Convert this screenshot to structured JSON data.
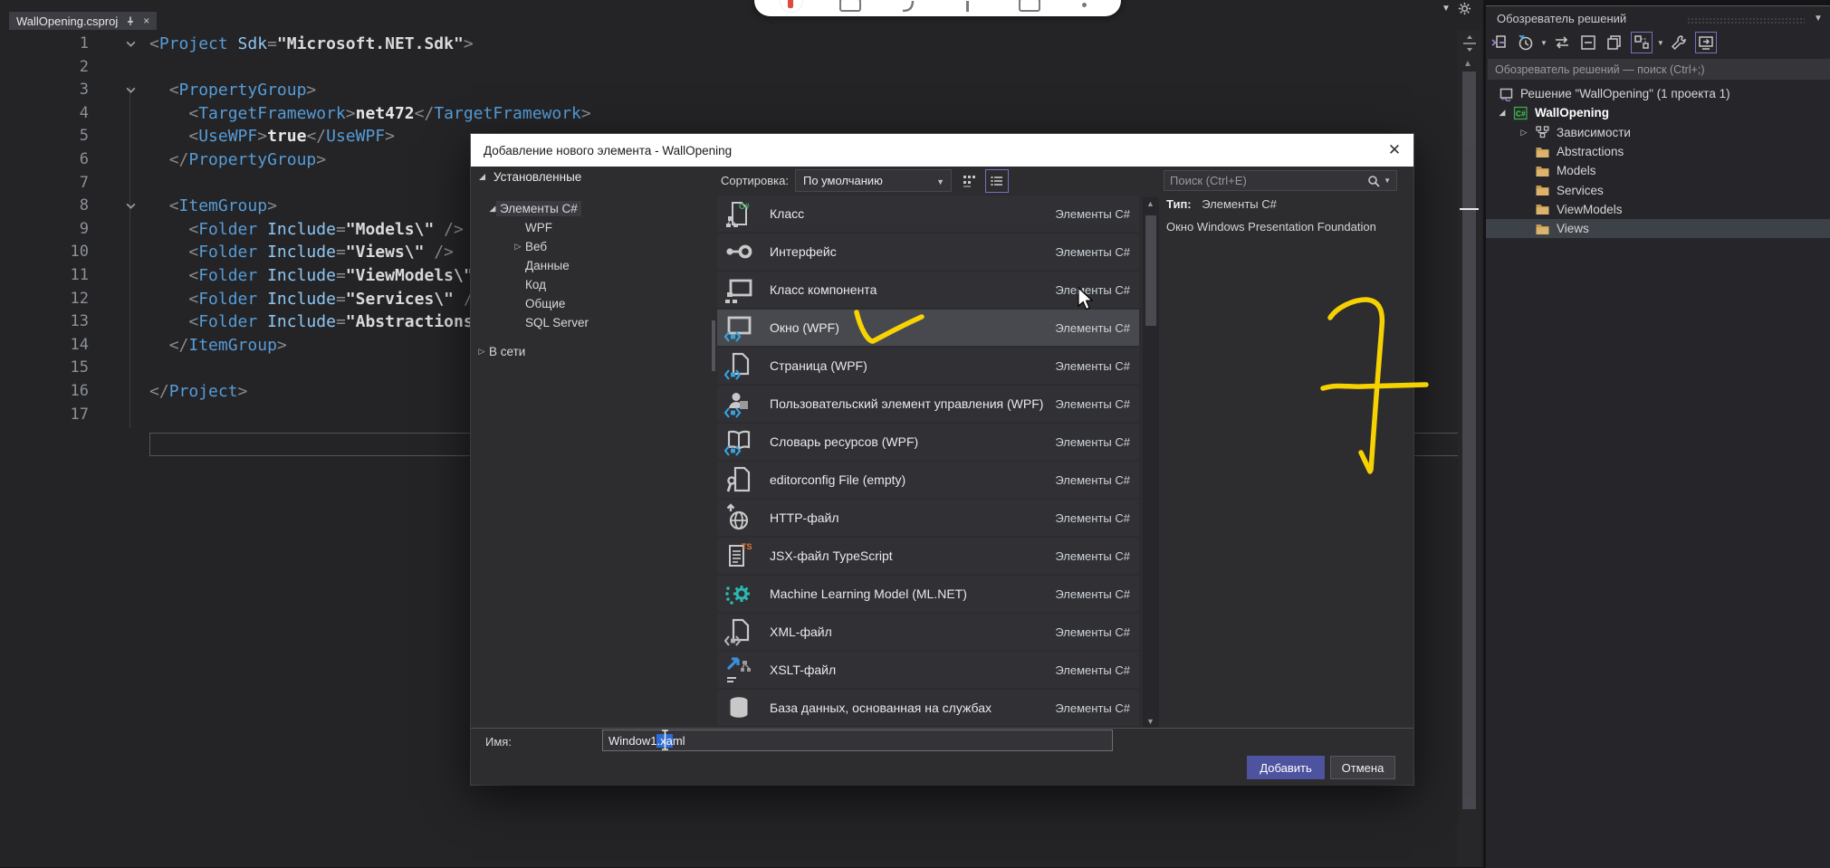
{
  "recorder": {
    "icons": [
      "record-icon",
      "screen-icon",
      "pen-icon",
      "divider",
      "camera-icon",
      "menu-dot-icon"
    ]
  },
  "editor": {
    "tab_title": "WallOpening.csproj",
    "lines": [
      {
        "n": 1,
        "fold": true,
        "tokens": [
          [
            "p",
            "<"
          ],
          [
            "t",
            "Project"
          ],
          [
            "x",
            " "
          ],
          [
            "a",
            "Sdk"
          ],
          [
            "p",
            "="
          ],
          [
            "s",
            "\"Microsoft.NET.Sdk\""
          ],
          [
            "p",
            ">"
          ]
        ]
      },
      {
        "n": 2,
        "tokens": []
      },
      {
        "n": 3,
        "fold": true,
        "tokens": [
          [
            "x",
            "  "
          ],
          [
            "p",
            "<"
          ],
          [
            "t",
            "PropertyGroup"
          ],
          [
            "p",
            ">"
          ]
        ]
      },
      {
        "n": 4,
        "tokens": [
          [
            "x",
            "    "
          ],
          [
            "p",
            "<"
          ],
          [
            "t",
            "TargetFramework"
          ],
          [
            "p",
            ">"
          ],
          [
            "x",
            "net472"
          ],
          [
            "p",
            "</"
          ],
          [
            "t",
            "TargetFramework"
          ],
          [
            "p",
            ">"
          ]
        ]
      },
      {
        "n": 5,
        "tokens": [
          [
            "x",
            "    "
          ],
          [
            "p",
            "<"
          ],
          [
            "t",
            "UseWPF"
          ],
          [
            "p",
            ">"
          ],
          [
            "x",
            "true"
          ],
          [
            "p",
            "</"
          ],
          [
            "t",
            "UseWPF"
          ],
          [
            "p",
            ">"
          ]
        ]
      },
      {
        "n": 6,
        "tokens": [
          [
            "x",
            "  "
          ],
          [
            "p",
            "</"
          ],
          [
            "t",
            "PropertyGroup"
          ],
          [
            "p",
            ">"
          ]
        ]
      },
      {
        "n": 7,
        "tokens": []
      },
      {
        "n": 8,
        "fold": true,
        "tokens": [
          [
            "x",
            "  "
          ],
          [
            "p",
            "<"
          ],
          [
            "t",
            "ItemGroup"
          ],
          [
            "p",
            ">"
          ]
        ]
      },
      {
        "n": 9,
        "tokens": [
          [
            "x",
            "    "
          ],
          [
            "p",
            "<"
          ],
          [
            "t",
            "Folder"
          ],
          [
            "x",
            " "
          ],
          [
            "a",
            "Include"
          ],
          [
            "p",
            "="
          ],
          [
            "s",
            "\"Models\\\""
          ],
          [
            "x",
            " "
          ],
          [
            "p",
            "/>"
          ]
        ]
      },
      {
        "n": 10,
        "tokens": [
          [
            "x",
            "    "
          ],
          [
            "p",
            "<"
          ],
          [
            "t",
            "Folder"
          ],
          [
            "x",
            " "
          ],
          [
            "a",
            "Include"
          ],
          [
            "p",
            "="
          ],
          [
            "s",
            "\"Views\\\""
          ],
          [
            "x",
            " "
          ],
          [
            "p",
            "/>"
          ]
        ]
      },
      {
        "n": 11,
        "tokens": [
          [
            "x",
            "    "
          ],
          [
            "p",
            "<"
          ],
          [
            "t",
            "Folder"
          ],
          [
            "x",
            " "
          ],
          [
            "a",
            "Include"
          ],
          [
            "p",
            "="
          ],
          [
            "s",
            "\"ViewModels\\\""
          ],
          [
            "x",
            " "
          ],
          [
            "p",
            "/>"
          ]
        ]
      },
      {
        "n": 12,
        "tokens": [
          [
            "x",
            "    "
          ],
          [
            "p",
            "<"
          ],
          [
            "t",
            "Folder"
          ],
          [
            "x",
            " "
          ],
          [
            "a",
            "Include"
          ],
          [
            "p",
            "="
          ],
          [
            "s",
            "\"Services\\\""
          ],
          [
            "x",
            " "
          ],
          [
            "p",
            "/>"
          ]
        ]
      },
      {
        "n": 13,
        "tokens": [
          [
            "x",
            "    "
          ],
          [
            "p",
            "<"
          ],
          [
            "t",
            "Folder"
          ],
          [
            "x",
            " "
          ],
          [
            "a",
            "Include"
          ],
          [
            "p",
            "="
          ],
          [
            "s",
            "\"Abstractions\\\""
          ],
          [
            "x",
            " "
          ],
          [
            "p",
            "/>"
          ]
        ]
      },
      {
        "n": 14,
        "tokens": [
          [
            "x",
            "  "
          ],
          [
            "p",
            "</"
          ],
          [
            "t",
            "ItemGroup"
          ],
          [
            "p",
            ">"
          ]
        ]
      },
      {
        "n": 15,
        "tokens": []
      },
      {
        "n": 16,
        "tokens": [
          [
            "p",
            "</"
          ],
          [
            "t",
            "Project"
          ],
          [
            "p",
            ">"
          ]
        ]
      },
      {
        "n": 17,
        "tokens": []
      }
    ]
  },
  "dialog": {
    "title": "Добавление нового элемента  - WallOpening",
    "installed_label": "Установленные",
    "categories": [
      {
        "label": "Элементы C#",
        "indent": 1,
        "state": "expanded",
        "highlight": true
      },
      {
        "label": "WPF",
        "indent": 2,
        "state": ""
      },
      {
        "label": "Веб",
        "indent": 2,
        "state": "collapsed"
      },
      {
        "label": "Данные",
        "indent": 2,
        "state": ""
      },
      {
        "label": "Код",
        "indent": 2,
        "state": ""
      },
      {
        "label": "Общие",
        "indent": 2,
        "state": ""
      },
      {
        "label": "SQL Server",
        "indent": 2,
        "state": ""
      },
      {
        "label": "В сети",
        "indent": 0,
        "state": "collapsed"
      }
    ],
    "sort_label": "Сортировка:",
    "sort_value": "По умолчанию",
    "search_placeholder": "Поиск (Ctrl+E)",
    "templates": [
      {
        "icon": "i-class",
        "label": "Класс",
        "category": "Элементы C#"
      },
      {
        "icon": "i-interface",
        "label": "Интерфейс",
        "category": "Элементы C#"
      },
      {
        "icon": "i-component",
        "label": "Класс компонента",
        "category": "Элементы C#"
      },
      {
        "icon": "i-wpf-window",
        "label": "Окно (WPF)",
        "category": "Элементы C#",
        "selected": true
      },
      {
        "icon": "i-wpf-page",
        "label": "Страница (WPF)",
        "category": "Элементы C#"
      },
      {
        "icon": "i-usercontrol",
        "label": "Пользовательский элемент управления (WPF)",
        "category": "Элементы C#"
      },
      {
        "icon": "i-resdict",
        "label": "Словарь ресурсов (WPF)",
        "category": "Элементы C#"
      },
      {
        "icon": "i-editorconfig",
        "label": "editorconfig File (empty)",
        "category": "Элементы C#"
      },
      {
        "icon": "i-http",
        "label": "HTTP-файл",
        "category": "Элементы C#"
      },
      {
        "icon": "i-jsx",
        "label": "JSX-файл TypeScript",
        "category": "Элементы C#"
      },
      {
        "icon": "i-mlnet",
        "label": "Machine Learning Model (ML.NET)",
        "category": "Элементы C#"
      },
      {
        "icon": "i-xml",
        "label": "XML-файл",
        "category": "Элементы C#"
      },
      {
        "icon": "i-xslt",
        "label": "XSLT-файл",
        "category": "Элементы C#"
      },
      {
        "icon": "i-database",
        "label": "База данных, основанная на службах",
        "category": "Элементы C#"
      }
    ],
    "info": {
      "type_label": "Тип:",
      "type_value": "Элементы C#",
      "description": "Окно Windows Presentation Foundation"
    },
    "name_label": "Имя:",
    "name_pre": "Window1",
    "name_sel": ".xa",
    "name_post": "ml",
    "add_label": "Добавить",
    "cancel_label": "Отмена"
  },
  "solution_explorer": {
    "title": "Обозреватель решений",
    "search_placeholder": "Обозреватель решений — поиск (Ctrl+;)",
    "toolbar": [
      "i-tb-home",
      "i-tb-pending",
      "i-tb-sync",
      "i-tb-collapse",
      "i-tb-copy",
      "i-tb-scope",
      "i-tb-wrench",
      "i-tb-preview"
    ],
    "toolbar_boxed": [
      5,
      7
    ],
    "items": [
      {
        "icon": "solution",
        "label": "Решение \"WallOpening\" (1 проекта 1)",
        "indent": 0,
        "expander": ""
      },
      {
        "icon": "csproj",
        "label": "WallOpening",
        "indent": 0,
        "expander": "expanded",
        "bold": true
      },
      {
        "icon": "dependencies",
        "label": "Зависимости",
        "indent": 1,
        "expander": "collapsed"
      },
      {
        "icon": "folder",
        "label": "Abstractions",
        "indent": 1,
        "expander": ""
      },
      {
        "icon": "folder",
        "label": "Models",
        "indent": 1,
        "expander": ""
      },
      {
        "icon": "folder",
        "label": "Services",
        "indent": 1,
        "expander": ""
      },
      {
        "icon": "folder",
        "label": "ViewModels",
        "indent": 1,
        "expander": ""
      },
      {
        "icon": "folder",
        "label": "Views",
        "indent": 1,
        "expander": "",
        "selected": true
      }
    ]
  },
  "colors": {
    "annotation_yellow": "#ffd900",
    "accent_button": "#4e53a0",
    "selection_blue": "#2e6bd6"
  }
}
